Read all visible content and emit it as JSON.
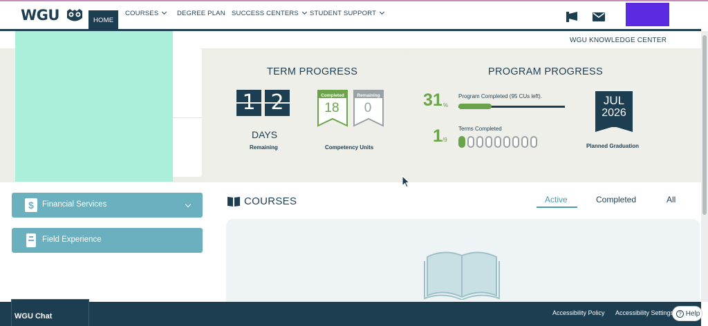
{
  "nav": {
    "logo": "WGU",
    "items": [
      {
        "label": "HOME"
      },
      {
        "label": "COURSES"
      },
      {
        "label": "DEGREE PLAN"
      },
      {
        "label": "SUCCESS CENTERS"
      },
      {
        "label": "STUDENT SUPPORT"
      }
    ],
    "knowledge_center": "WGU KNOWLEDGE CENTER"
  },
  "term_progress": {
    "title": "TERM PROGRESS",
    "digits": [
      "1",
      "2"
    ],
    "days_label": "DAYS",
    "remaining_label": "Remaining",
    "completed_caption": "Completed",
    "completed_value": "18",
    "remaining_caption": "Remaining",
    "remaining_value": "0",
    "cu_label": "Competency Units"
  },
  "program_progress": {
    "title": "PROGRAM PROGRESS",
    "percent": "31",
    "percent_unit": "%",
    "percent_label": "Program Completed (95 CUs left).",
    "percent_fraction": 0.31,
    "terms_done": "1",
    "terms_total": "/9",
    "terms_label": "Terms Completed",
    "terms_completed_count": 1,
    "terms_total_count": 9,
    "grad_month": "JUL",
    "grad_year": "2026",
    "grad_label": "Planned Graduation"
  },
  "sidebar": {
    "buttons": [
      {
        "label": "Financial Services"
      },
      {
        "label": "Field Experience"
      }
    ]
  },
  "courses": {
    "title": "COURSES",
    "tabs": [
      {
        "label": "Active"
      },
      {
        "label": "Completed"
      },
      {
        "label": "All"
      }
    ]
  },
  "footer": {
    "chat": "WGU Chat",
    "accessibility_policy": "Accessibility Policy",
    "accessibility_settings": "Accessibility Settings",
    "help": "Help"
  },
  "colors": {
    "navy": "#1d3d50",
    "green": "#6ba34b",
    "teal_button": "#6ab0be",
    "mint_redaction": "#abeeda",
    "purple_redaction": "#5a2be0"
  }
}
